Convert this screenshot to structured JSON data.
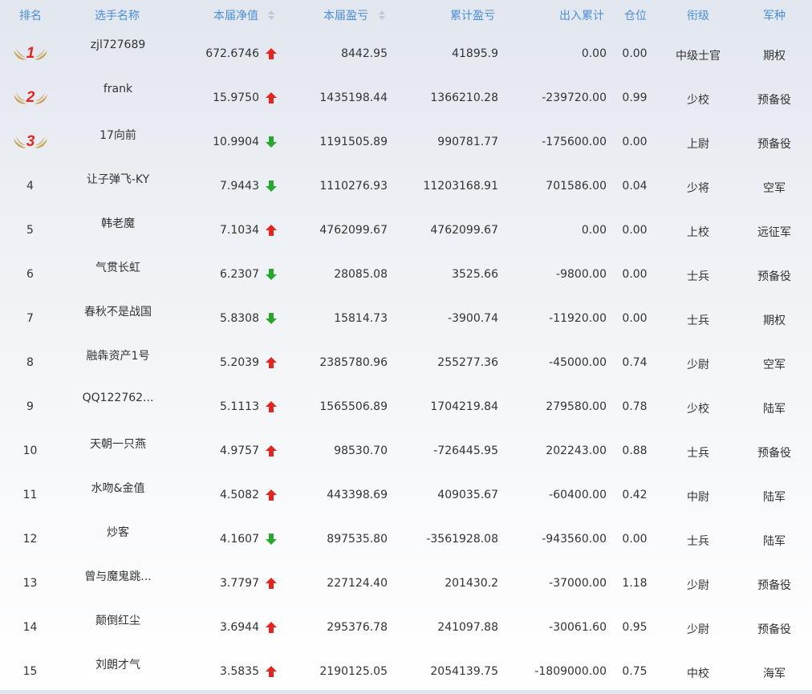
{
  "headers": {
    "rank": "排名",
    "name": "选手名称",
    "net_value": "本届净值",
    "current_pnl": "本届盈亏",
    "accum_pnl": "累计盈亏",
    "in_out": "出入累计",
    "position": "仓位",
    "title": "衔级",
    "branch": "军种"
  },
  "colors": {
    "header_text": "#4a8fd8",
    "up": "#e2261f",
    "down": "#27a82d",
    "medal_text": "#e2261f",
    "medal_wing": "#c9a25a"
  },
  "rows": [
    {
      "rank": "1",
      "name": "zjl727689",
      "nv": "672.6746",
      "trend": "up",
      "cur": "8442.95",
      "acc": "41895.9",
      "flow": "0.00",
      "pos": "0.00",
      "title": "中级士官",
      "branch": "期权"
    },
    {
      "rank": "2",
      "name": "frank",
      "nv": "15.9750",
      "trend": "up",
      "cur": "1435198.44",
      "acc": "1366210.28",
      "flow": "-239720.00",
      "pos": "0.99",
      "title": "少校",
      "branch": "预备役"
    },
    {
      "rank": "3",
      "name": "17向前",
      "nv": "10.9904",
      "trend": "down",
      "cur": "1191505.89",
      "acc": "990781.77",
      "flow": "-175600.00",
      "pos": "0.00",
      "title": "上尉",
      "branch": "预备役"
    },
    {
      "rank": "4",
      "name": "让子弹飞-KY",
      "nv": "7.9443",
      "trend": "down",
      "cur": "1110276.93",
      "acc": "11203168.91",
      "flow": "701586.00",
      "pos": "0.04",
      "title": "少将",
      "branch": "空军"
    },
    {
      "rank": "5",
      "name": "韩老魔",
      "nv": "7.1034",
      "trend": "up",
      "cur": "4762099.67",
      "acc": "4762099.67",
      "flow": "0.00",
      "pos": "0.00",
      "title": "上校",
      "branch": "远征军"
    },
    {
      "rank": "6",
      "name": "气贯长虹",
      "nv": "6.2307",
      "trend": "down",
      "cur": "28085.08",
      "acc": "3525.66",
      "flow": "-9800.00",
      "pos": "0.00",
      "title": "士兵",
      "branch": "预备役"
    },
    {
      "rank": "7",
      "name": "春秋不是战国",
      "nv": "5.8308",
      "trend": "down",
      "cur": "15814.73",
      "acc": "-3900.74",
      "flow": "-11920.00",
      "pos": "0.00",
      "title": "士兵",
      "branch": "期权"
    },
    {
      "rank": "8",
      "name": "融犇资产1号",
      "nv": "5.2039",
      "trend": "up",
      "cur": "2385780.96",
      "acc": "255277.36",
      "flow": "-45000.00",
      "pos": "0.74",
      "title": "少尉",
      "branch": "空军"
    },
    {
      "rank": "9",
      "name": "QQ122762...",
      "nv": "5.1113",
      "trend": "up",
      "cur": "1565506.89",
      "acc": "1704219.84",
      "flow": "279580.00",
      "pos": "0.78",
      "title": "少校",
      "branch": "陆军"
    },
    {
      "rank": "10",
      "name": "天朝一只燕",
      "nv": "4.9757",
      "trend": "up",
      "cur": "98530.70",
      "acc": "-726445.95",
      "flow": "202243.00",
      "pos": "0.88",
      "title": "士兵",
      "branch": "预备役"
    },
    {
      "rank": "11",
      "name": "水吻&金值",
      "nv": "4.5082",
      "trend": "up",
      "cur": "443398.69",
      "acc": "409035.67",
      "flow": "-60400.00",
      "pos": "0.42",
      "title": "中尉",
      "branch": "陆军"
    },
    {
      "rank": "12",
      "name": "炒客",
      "nv": "4.1607",
      "trend": "down",
      "cur": "897535.80",
      "acc": "-3561928.08",
      "flow": "-943560.00",
      "pos": "0.00",
      "title": "士兵",
      "branch": "陆军"
    },
    {
      "rank": "13",
      "name": "曾与魔鬼跳...",
      "nv": "3.7797",
      "trend": "up",
      "cur": "227124.40",
      "acc": "201430.2",
      "flow": "-37000.00",
      "pos": "1.18",
      "title": "少尉",
      "branch": "预备役"
    },
    {
      "rank": "14",
      "name": "颠倒红尘",
      "nv": "3.6944",
      "trend": "up",
      "cur": "295376.78",
      "acc": "241097.88",
      "flow": "-30061.60",
      "pos": "0.95",
      "title": "少尉",
      "branch": "预备役"
    },
    {
      "rank": "15",
      "name": "刘朗才气",
      "nv": "3.5835",
      "trend": "up",
      "cur": "2190125.05",
      "acc": "2054139.75",
      "flow": "-1809000.00",
      "pos": "0.75",
      "title": "中校",
      "branch": "海军"
    }
  ]
}
